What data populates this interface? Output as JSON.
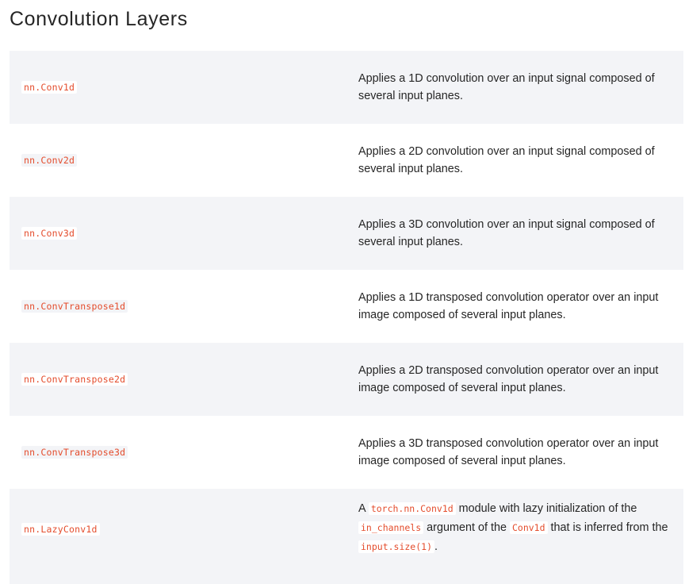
{
  "page": {
    "title": "Convolution Layers"
  },
  "colors": {
    "code_text": "#e44c2c",
    "row_shaded": "#f3f4f7",
    "row_plain": "#ffffff",
    "text": "#262626"
  },
  "rows": [
    {
      "name": "nn.Conv1d",
      "description": "Applies a 1D convolution over an input signal composed of several input planes."
    },
    {
      "name": "nn.Conv2d",
      "description": "Applies a 2D convolution over an input signal composed of several input planes."
    },
    {
      "name": "nn.Conv3d",
      "description": "Applies a 3D convolution over an input signal composed of several input planes."
    },
    {
      "name": "nn.ConvTranspose1d",
      "description": "Applies a 1D transposed convolution operator over an input image composed of several input planes."
    },
    {
      "name": "nn.ConvTranspose2d",
      "description": "Applies a 2D transposed convolution operator over an input image composed of several input planes."
    },
    {
      "name": "nn.ConvTranspose3d",
      "description": "Applies a 3D transposed convolution operator over an input image composed of several input planes."
    },
    {
      "name": "nn.LazyConv1d",
      "description_parts": {
        "p1": "A ",
        "c1": "torch.nn.Conv1d",
        "p2": " module with lazy initialization of the ",
        "c2": "in_channels",
        "p3": " argument of the ",
        "c3": "Conv1d",
        "p4": " that is inferred from the ",
        "c4": "input.size(1)",
        "p5": "."
      }
    }
  ]
}
